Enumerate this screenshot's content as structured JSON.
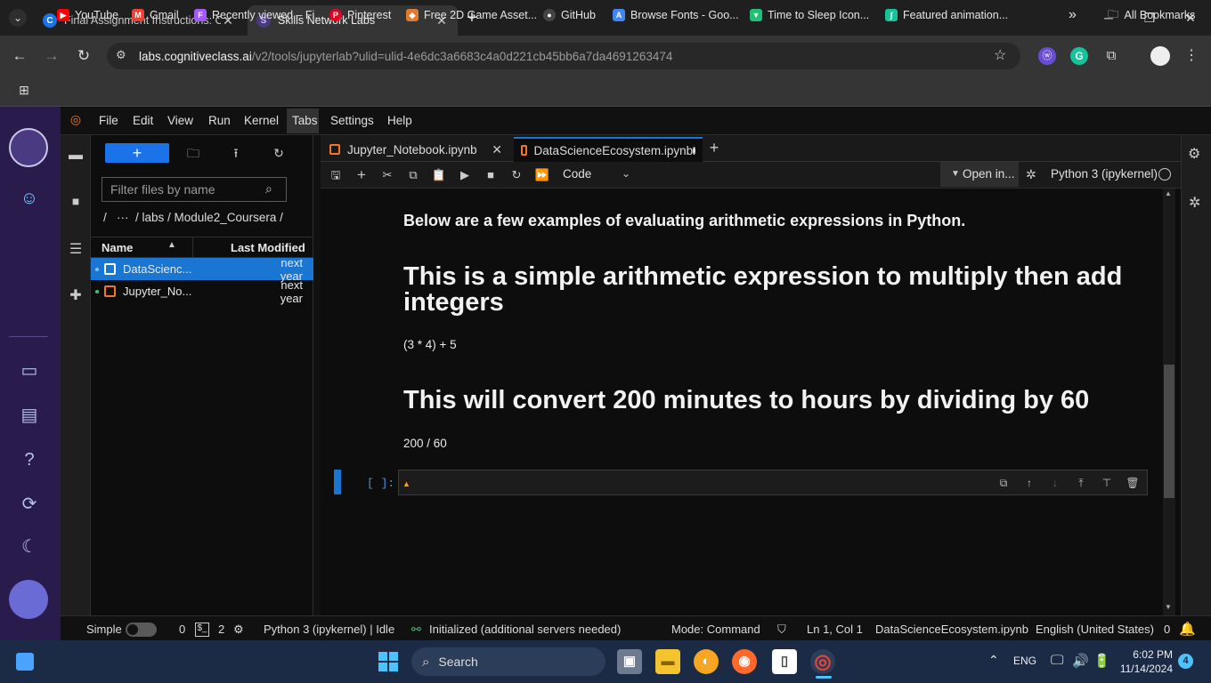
{
  "browser": {
    "tabs": [
      {
        "title": "Final Assignment Instructions: C",
        "favicon": "C",
        "active": false
      },
      {
        "title": "Skills Network Labs",
        "favicon": "S",
        "active": true
      }
    ],
    "new_tab_label": "+",
    "url_host": "labs.cognitiveclass.ai",
    "url_path": "/v2/tools/jupyterlab?ulid=ulid-4e6dc3a6683c4a0d221cb45bb6a7da4691263474",
    "bookmarks": [
      {
        "label": "YouTube",
        "color": "#ff0000"
      },
      {
        "label": "Gmail",
        "color": "#ea4335"
      },
      {
        "label": "Recently viewed – Fi...",
        "color": "#a259ff"
      },
      {
        "label": "Pinterest",
        "color": "#e60023"
      },
      {
        "label": "Free 2D Game Asset...",
        "color": "#e07a2f"
      },
      {
        "label": "GitHub",
        "color": "#444444"
      },
      {
        "label": "Browse Fonts - Goo...",
        "color": "#4285f4"
      },
      {
        "label": "Time to Sleep Icon...",
        "color": "#1fbf75"
      },
      {
        "label": "Featured animation...",
        "color": "#18c39a"
      }
    ],
    "more_bookmarks": "»",
    "all_bookmarks": "All Bookmarks"
  },
  "jupyter": {
    "menu": [
      "File",
      "Edit",
      "View",
      "Run",
      "Kernel",
      "Tabs",
      "Settings",
      "Help"
    ],
    "filter_placeholder": "Filter files by name",
    "breadcrumb": "/   ···  / labs / Module2_Coursera /",
    "columns": {
      "name": "Name",
      "modified": "Last Modified"
    },
    "files": [
      {
        "name": "DataScienc...",
        "modified": "next year",
        "selected": true
      },
      {
        "name": "Jupyter_No...",
        "modified": "next year",
        "selected": false
      }
    ],
    "notebook_tabs": [
      {
        "title": "Jupyter_Notebook.ipynb",
        "active": false
      },
      {
        "title": "DataScienceEcosystem.ipynb",
        "active": true
      }
    ],
    "cell_type": "Code",
    "open_in": "Open in...",
    "kernel": "Python 3 (ipykernel)",
    "content": {
      "intro": "Below are a few examples of evaluating arithmetic expressions in Python.",
      "heading1": "This is a simple arithmetic expression to multiply then add integers",
      "code1": "(3 * 4) + 5",
      "heading2": "This will convert 200 minutes to hours by dividing by 60",
      "code2": "200 / 60",
      "prompt": "[ ]:"
    },
    "status": {
      "mode_label": "Simple",
      "terminals": "0",
      "kernels": "2",
      "kernel_state": "Python 3 (ipykernel) | Idle",
      "init": "Initialized (additional servers needed)",
      "mode": "Mode: Command",
      "position": "Ln 1, Col 1",
      "file": "DataScienceEcosystem.ipynb",
      "language": "English (United States)",
      "notifications": "0"
    }
  },
  "taskbar": {
    "search": "Search",
    "lang": "ENG",
    "time": "6:02 PM",
    "date": "11/14/2024",
    "badge": "4"
  }
}
